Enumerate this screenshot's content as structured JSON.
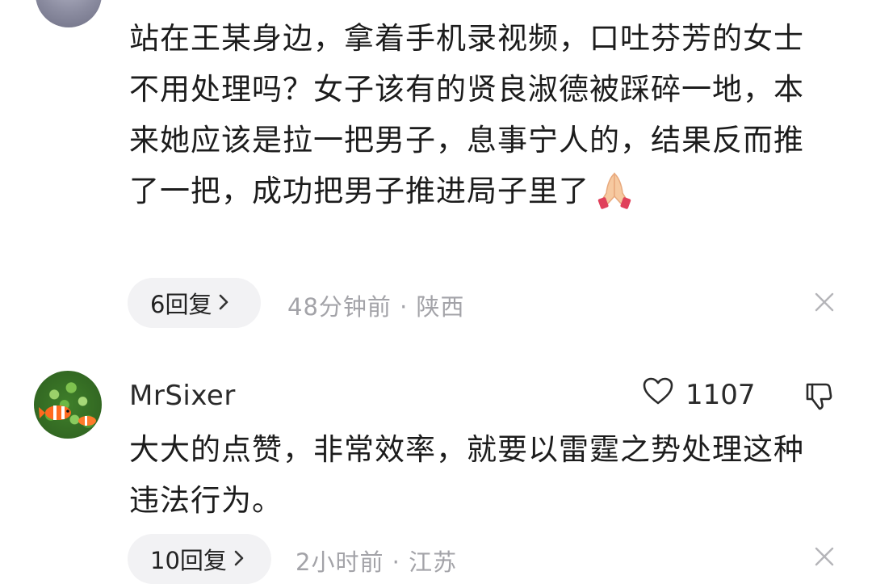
{
  "comments": [
    {
      "text": "站在王某身边，拿着手机录视频，口吐芬芳的女士不用处理吗？女子该有的贤良淑德被踩碎一地，本来她应该是拉一把男子，息事宁人的，结果反而推了一把，成功把男子推进局子里了",
      "emoji": "folded-hands-emoji",
      "reply_label": "6回复",
      "meta": "48分钟前 · 陕西"
    },
    {
      "username": "MrSixer",
      "like_count": "1107",
      "text": "大大的点赞，非常效率，就要以雷霆之势处理这种违法行为。",
      "reply_label": "10回复",
      "meta": "2小时前 · 江苏"
    }
  ],
  "icons": {
    "heart": "heart-icon",
    "dislike": "thumbs-down-icon",
    "close": "close-icon",
    "chevron": "chevron-right-icon"
  },
  "colors": {
    "background": "#ffffff",
    "pill": "#f2f2f4",
    "meta": "#a3a3a8",
    "text": "#1c1c1c"
  }
}
